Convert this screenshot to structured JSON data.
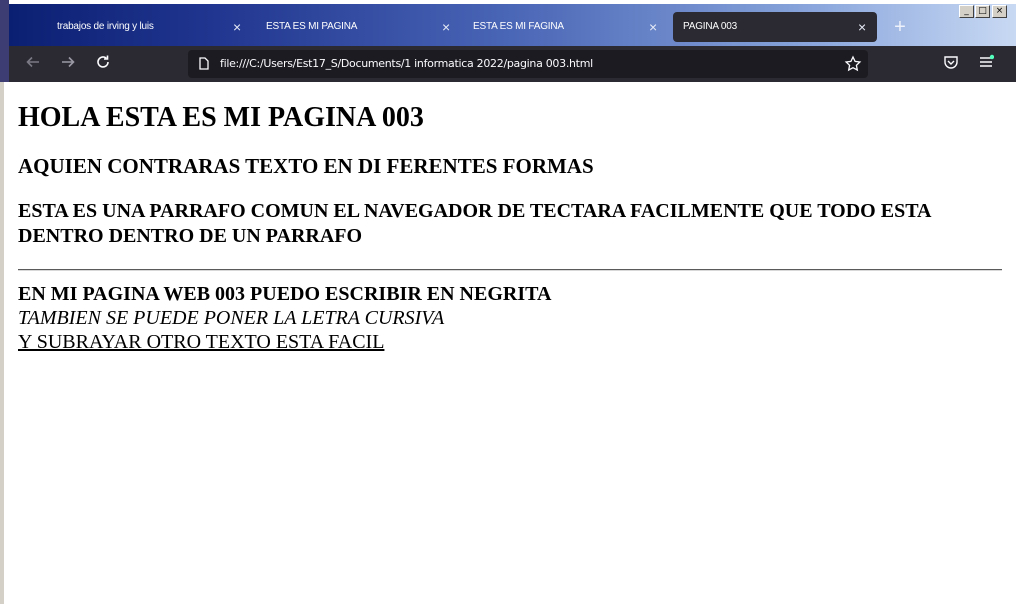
{
  "browser": {
    "tabs": [
      {
        "label": "trabajos de irving y luis",
        "active": false
      },
      {
        "label": "ESTA ES MI PAGINA",
        "active": false
      },
      {
        "label": "ESTA ES MI FAGINA",
        "active": false
      },
      {
        "label": "PAGINA 003",
        "active": true
      }
    ],
    "new_tab_label": "+",
    "close_glyph": "×",
    "url": "file:///C:/Users/Est17_S/Documents/1 informatica 2022/pagina 003.html",
    "icons": [
      "back-icon",
      "forward-icon",
      "reload-icon",
      "document-icon",
      "bookmark-star-icon",
      "pocket-icon",
      "menu-icon"
    ],
    "window_controls": [
      "_",
      "□",
      "×"
    ]
  },
  "page": {
    "heading": "HOLA ESTA ES MI PAGINA 003",
    "subheading": "AQUIEN CONTRARAS TEXTO EN DI FERENTES FORMAS",
    "paragraph": "ESTA ES UNA PARRAFO COMUN EL NAVEGADOR DE TECTARA FACILMENTE QUE TODO ESTA DENTRO DENTRO DE UN PARRAFO",
    "bold_text": "EN MI PAGINA WEB 003 PUEDO ESCRIBIR EN NEGRITA",
    "italic_text": "TAMBIEN SE PUEDE PONER LA LETRA CURSIVA",
    "underline_text": "Y SUBRAYAR OTRO TEXTO ESTA FACIL"
  },
  "colors": {
    "toolbar": "#2b2a33",
    "urlbar": "#1c1b22",
    "tab_gradient_start": "#0b1f72",
    "tab_gradient_end": "#c8d9f3"
  }
}
